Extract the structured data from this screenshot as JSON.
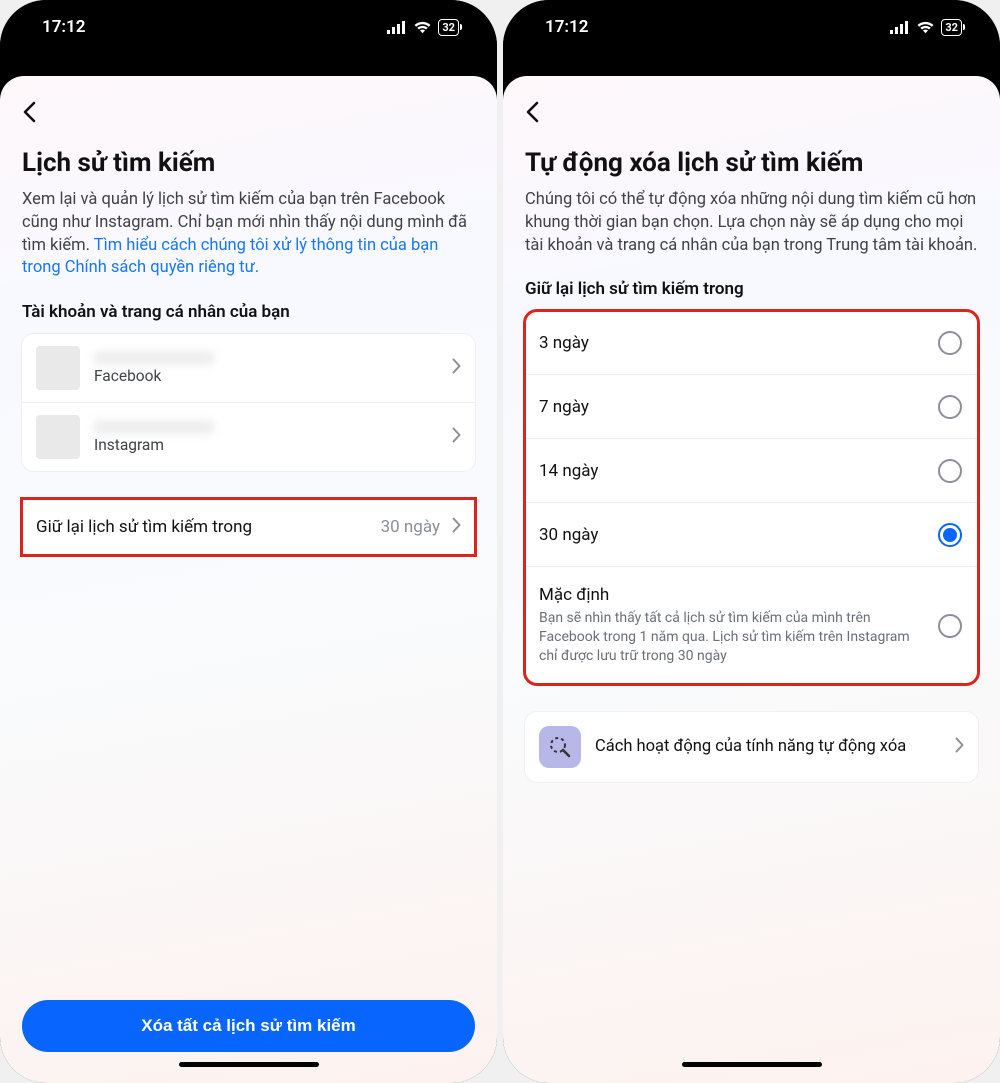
{
  "status": {
    "time": "17:12",
    "battery": "32"
  },
  "left": {
    "title": "Lịch sử tìm kiếm",
    "desc_plain": "Xem lại và quản lý lịch sử tìm kiếm của bạn trên Facebook cũng như Instagram. Chỉ bạn mới nhìn thấy nội dung mình đã tìm kiếm. ",
    "desc_link": "Tìm hiểu cách chúng tôi xử lý thông tin của bạn trong Chính sách quyền riêng tư.",
    "section_label": "Tài khoản và trang cá nhân của bạn",
    "accounts": [
      {
        "platform": "Facebook"
      },
      {
        "platform": "Instagram"
      }
    ],
    "keep_label": "Giữ lại lịch sử tìm kiếm trong",
    "keep_value": "30 ngày",
    "clear_button": "Xóa tất cả lịch sử tìm kiếm"
  },
  "right": {
    "title": "Tự động xóa lịch sử tìm kiếm",
    "desc": "Chúng tôi có thể tự động xóa những nội dung tìm kiếm cũ hơn khung thời gian bạn chọn. Lựa chọn này sẽ áp dụng cho mọi tài khoản và trang cá nhân của bạn trong Trung tâm tài khoản.",
    "section_label": "Giữ lại lịch sử tìm kiếm trong",
    "options": [
      {
        "label": "3 ngày",
        "sub": "",
        "checked": false
      },
      {
        "label": "7 ngày",
        "sub": "",
        "checked": false
      },
      {
        "label": "14 ngày",
        "sub": "",
        "checked": false
      },
      {
        "label": "30 ngày",
        "sub": "",
        "checked": true
      },
      {
        "label": "Mặc định",
        "sub": "Bạn sẽ nhìn thấy tất cả lịch sử tìm kiếm của mình trên Facebook trong 1 năm qua. Lịch sử tìm kiếm trên Instagram chỉ được lưu trữ trong 30 ngày",
        "checked": false
      }
    ],
    "info_card": "Cách hoạt động của tính năng tự động xóa"
  }
}
